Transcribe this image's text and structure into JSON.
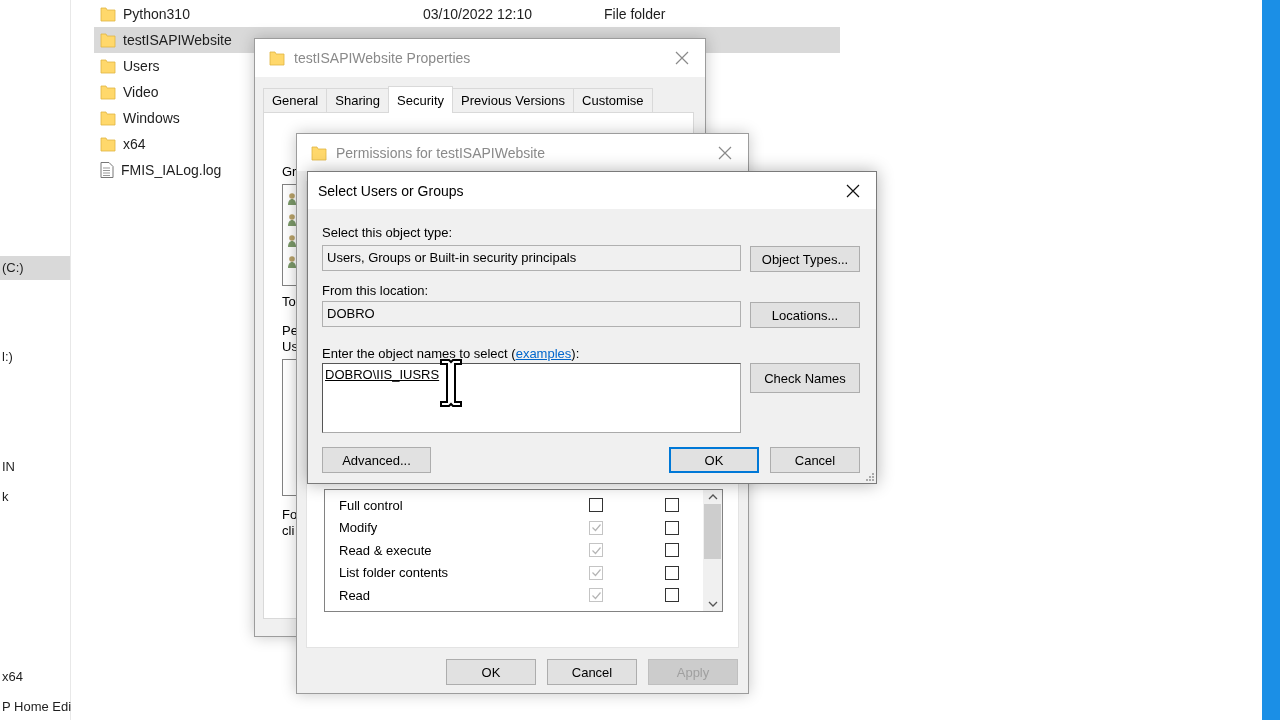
{
  "explorer": {
    "sidebar_items": [
      {
        "label": "(C:)",
        "selected": true
      },
      {
        "label": "l:)",
        "selected": false
      },
      {
        "label": "IN",
        "selected": false
      },
      {
        "label": "k",
        "selected": false
      },
      {
        "label": "x64",
        "selected": false
      },
      {
        "label": "P Home Edi",
        "selected": false
      }
    ],
    "files": [
      {
        "name": "Python310",
        "kind": "folder",
        "modified": "03/10/2022 12:10",
        "type": "File folder",
        "selected": false
      },
      {
        "name": "testISAPIWebsite",
        "kind": "folder",
        "selected": true
      },
      {
        "name": "Users",
        "kind": "folder",
        "selected": false
      },
      {
        "name": "Video",
        "kind": "folder",
        "selected": false
      },
      {
        "name": "Windows",
        "kind": "folder",
        "selected": false
      },
      {
        "name": "x64",
        "kind": "folder",
        "selected": false
      },
      {
        "name": "FMIS_IALog.log",
        "kind": "file",
        "selected": false
      }
    ]
  },
  "properties": {
    "title": "testISAPIWebsite Properties",
    "tabs": [
      {
        "label": "General",
        "selected": false
      },
      {
        "label": "Sharing",
        "selected": false
      },
      {
        "label": "Security",
        "selected": true
      },
      {
        "label": "Previous Versions",
        "selected": false
      },
      {
        "label": "Customise",
        "selected": false
      }
    ],
    "fragments": [
      "Gr",
      "To",
      "Pe",
      "Us",
      "Fo",
      "cli"
    ]
  },
  "permissions": {
    "title": "Permissions for testISAPIWebsite",
    "rows": [
      {
        "label": "Full control",
        "allow": false,
        "allow_inherited": false,
        "deny": false
      },
      {
        "label": "Modify",
        "allow": true,
        "allow_inherited": true,
        "deny": false
      },
      {
        "label": "Read & execute",
        "allow": true,
        "allow_inherited": true,
        "deny": false
      },
      {
        "label": "List folder contents",
        "allow": true,
        "allow_inherited": true,
        "deny": false
      },
      {
        "label": "Read",
        "allow": true,
        "allow_inherited": true,
        "deny": false
      }
    ],
    "buttons": [
      {
        "label": "OK",
        "disabled": false
      },
      {
        "label": "Cancel",
        "disabled": false
      },
      {
        "label": "Apply",
        "disabled": true
      }
    ]
  },
  "select_dialog": {
    "title": "Select Users or Groups",
    "object_type_label": "Select this object type:",
    "object_type": "Users, Groups or Built-in security principals",
    "object_types_button": "Object Types...",
    "location_label": "From this location:",
    "location": "DOBRO",
    "locations_button": "Locations...",
    "names_label": "Enter the object names to select (",
    "names_link": "examples",
    "names_label_end": "):",
    "names_value": "DOBRO\\IIS_IUSRS",
    "check_names_button": "Check Names",
    "advanced_button": "Advanced...",
    "ok_button": "OK",
    "cancel_button": "Cancel"
  }
}
